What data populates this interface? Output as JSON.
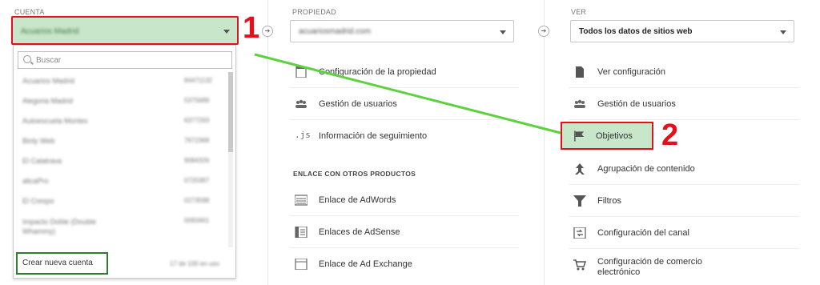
{
  "columns": {
    "account": {
      "label": "CUENTA",
      "selected": "Acuarios Madrid"
    },
    "property": {
      "label": "PROPIEDAD",
      "selected": "acuariosmadrid.com"
    },
    "view": {
      "label": "VER",
      "selected": "Todos los datos de sitios web"
    }
  },
  "account_panel": {
    "search_placeholder": "Buscar",
    "accounts": [
      {
        "name": "Acuarios Madrid",
        "id": "84471132"
      },
      {
        "name": "Alegoria Madrid",
        "id": "5375689"
      },
      {
        "name": "Autoescuela Montes",
        "id": "6377293"
      },
      {
        "name": "Binly Web",
        "id": "7672368"
      },
      {
        "name": "El Calatrava",
        "id": "9084326"
      },
      {
        "name": "alicaPro",
        "id": "0720387"
      },
      {
        "name": "El Crespo",
        "id": "0273598"
      },
      {
        "name": "Impacto Doble (Double Whammy)",
        "id": "0093461"
      }
    ],
    "create_label": "Crear nueva cuenta",
    "footer_note": "17 de 100 en uso"
  },
  "property_menu": {
    "items": [
      {
        "label": "Configuración de la propiedad",
        "icon": "document-icon"
      },
      {
        "label": "Gestión de usuarios",
        "icon": "users-icon"
      },
      {
        "label": "Información de seguimiento",
        "icon": "js-icon"
      }
    ],
    "section_title": "ENLACE CON OTROS PRODUCTOS",
    "links": [
      {
        "label": "Enlace de AdWords",
        "icon": "adwords-icon"
      },
      {
        "label": "Enlaces de AdSense",
        "icon": "adsense-icon"
      },
      {
        "label": "Enlace de Ad Exchange",
        "icon": "adexchange-icon"
      }
    ]
  },
  "view_menu": {
    "items": [
      {
        "label": "Ver configuración",
        "icon": "document-icon"
      },
      {
        "label": "Gestión de usuarios",
        "icon": "users-icon"
      },
      {
        "label": "Objetivos",
        "icon": "flag-icon"
      },
      {
        "label": "Agrupación de contenido",
        "icon": "grouping-icon"
      },
      {
        "label": "Filtros",
        "icon": "filter-icon"
      },
      {
        "label": "Configuración del canal",
        "icon": "channel-icon"
      },
      {
        "label": "Configuración de comercio electrónico",
        "icon": "cart-icon"
      }
    ]
  },
  "annotations": {
    "step1": "1",
    "step2": "2"
  },
  "colors": {
    "highlight_green": "#c8e6c9",
    "annotation_red": "#e5101b",
    "arrow_green": "#5ed13e"
  }
}
